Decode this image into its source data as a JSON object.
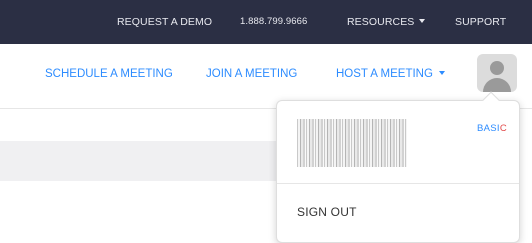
{
  "topbar": {
    "background": "#2b2f44",
    "request_demo": "REQUEST A DEMO",
    "phone": "1.888.799.9666",
    "resources": "RESOURCES",
    "support": "SUPPORT"
  },
  "nav": {
    "accent": "#2d8cff",
    "schedule": "SCHEDULE A MEETING",
    "join": "JOIN A MEETING",
    "host": "HOST A MEETING",
    "avatar_icon": "user-avatar-icon"
  },
  "dropdown": {
    "plan_main": "BASI",
    "plan_accent": "C",
    "plan_accent_color": "#e24a4a",
    "sign_out": "SIGN OUT"
  }
}
